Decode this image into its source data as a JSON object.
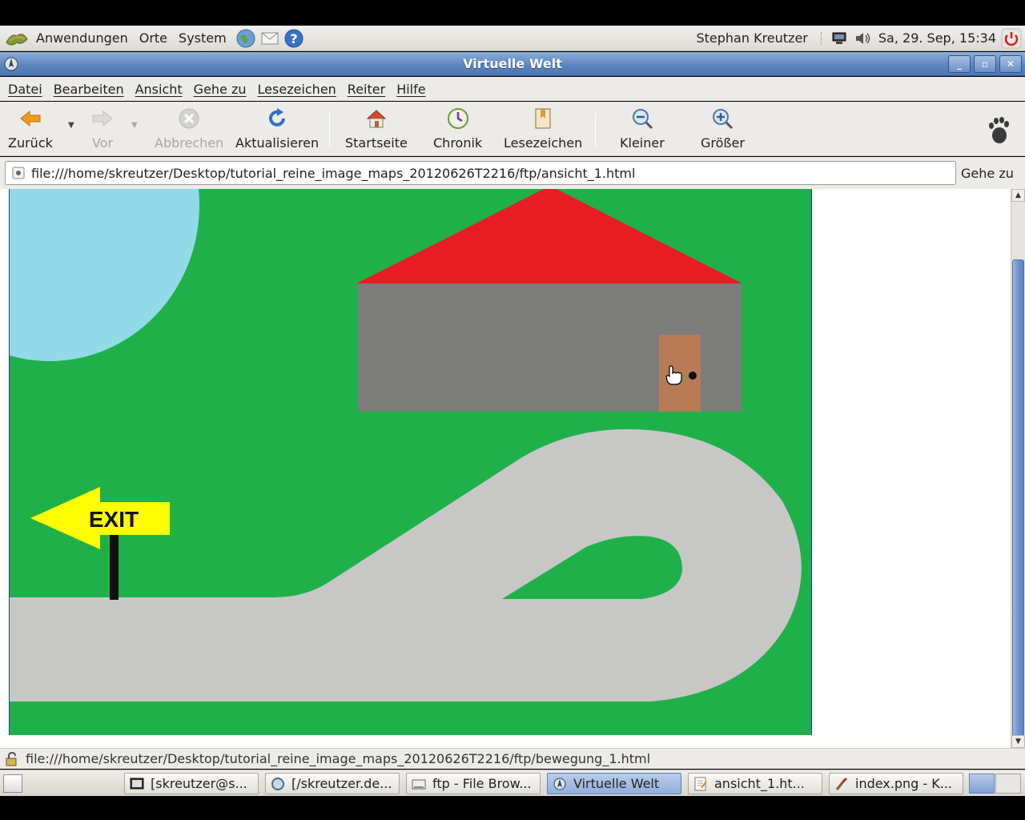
{
  "top_panel": {
    "menus": [
      "Anwendungen",
      "Orte",
      "System"
    ],
    "user": "Stephan Kreutzer",
    "clock": "Sa, 29. Sep, 15:34",
    "launchers": [
      "web-browser-icon",
      "mail-icon",
      "help-icon"
    ]
  },
  "window": {
    "title": "Virtuelle Welt"
  },
  "menubar": [
    "Datei",
    "Bearbeiten",
    "Ansicht",
    "Gehe zu",
    "Lesezeichen",
    "Reiter",
    "Hilfe"
  ],
  "toolbar": {
    "back": "Zurück",
    "forward": "Vor",
    "stop": "Abbrechen",
    "reload": "Aktualisieren",
    "home": "Startseite",
    "history": "Chronik",
    "bookmarks": "Lesezeichen",
    "zoom_out": "Kleiner",
    "zoom_in": "Größer"
  },
  "location": {
    "url": "file:///home/skreutzer/Desktop/tutorial_reine_image_maps_20120626T2216/ftp/ansicht_1.html",
    "go_label": "Gehe zu"
  },
  "scene": {
    "sign_text": "EXIT",
    "colors": {
      "grass": "#20b04a",
      "pond": "#93dae9",
      "roof": "#e81c23",
      "wall": "#7c7d7b",
      "door": "#b57c55",
      "road": "#c7c8c6",
      "sign": "#ffff00"
    }
  },
  "statusbar": {
    "text": "file:///home/skreutzer/Desktop/tutorial_reine_image_maps_20120626T2216/ftp/bewegung_1.html"
  },
  "taskbar": {
    "tasks": [
      {
        "label": "[skreutzer@s...",
        "active": false
      },
      {
        "label": "[/skreutzer.de...",
        "active": false
      },
      {
        "label": "ftp - File Brow...",
        "active": false
      },
      {
        "label": "Virtuelle Welt",
        "active": true
      },
      {
        "label": "ansicht_1.ht...",
        "active": false
      },
      {
        "label": "index.png - K...",
        "active": false
      }
    ]
  }
}
